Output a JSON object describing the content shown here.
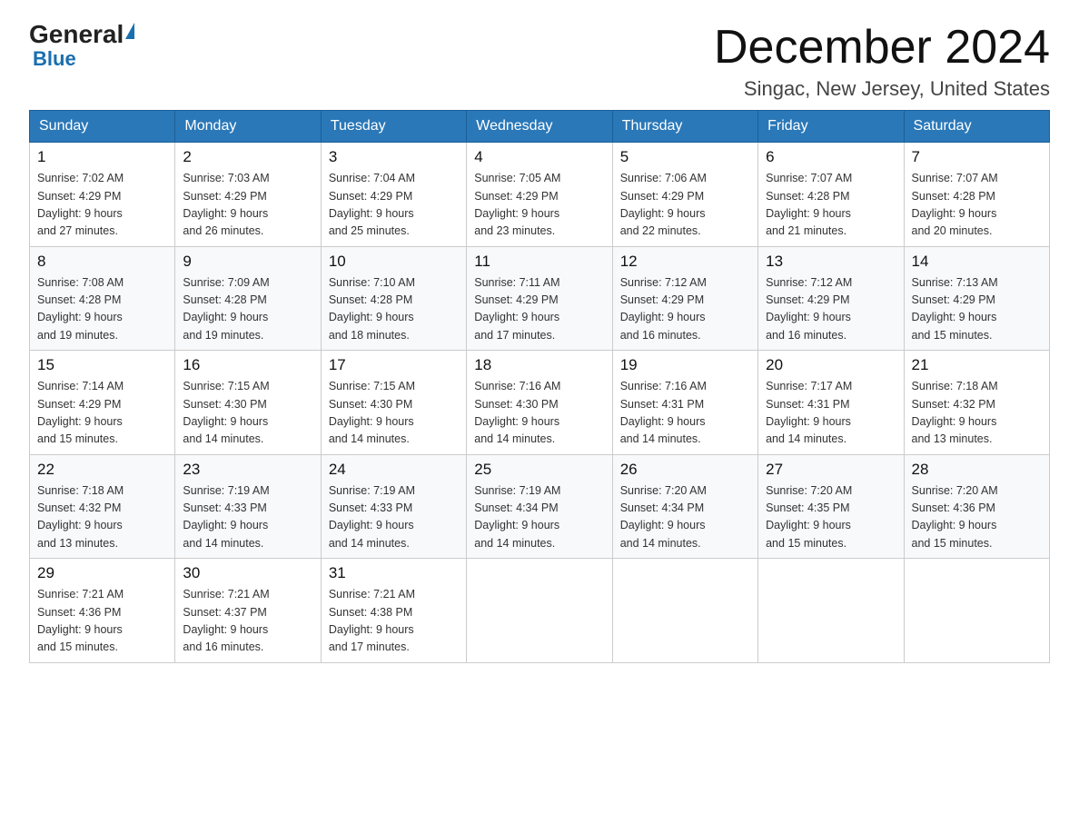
{
  "header": {
    "logo_general": "General",
    "logo_blue": "Blue",
    "month_title": "December 2024",
    "location": "Singac, New Jersey, United States"
  },
  "weekdays": [
    "Sunday",
    "Monday",
    "Tuesday",
    "Wednesday",
    "Thursday",
    "Friday",
    "Saturday"
  ],
  "weeks": [
    [
      {
        "day": "1",
        "sunrise": "7:02 AM",
        "sunset": "4:29 PM",
        "daylight": "9 hours and 27 minutes."
      },
      {
        "day": "2",
        "sunrise": "7:03 AM",
        "sunset": "4:29 PM",
        "daylight": "9 hours and 26 minutes."
      },
      {
        "day": "3",
        "sunrise": "7:04 AM",
        "sunset": "4:29 PM",
        "daylight": "9 hours and 25 minutes."
      },
      {
        "day": "4",
        "sunrise": "7:05 AM",
        "sunset": "4:29 PM",
        "daylight": "9 hours and 23 minutes."
      },
      {
        "day": "5",
        "sunrise": "7:06 AM",
        "sunset": "4:29 PM",
        "daylight": "9 hours and 22 minutes."
      },
      {
        "day": "6",
        "sunrise": "7:07 AM",
        "sunset": "4:28 PM",
        "daylight": "9 hours and 21 minutes."
      },
      {
        "day": "7",
        "sunrise": "7:07 AM",
        "sunset": "4:28 PM",
        "daylight": "9 hours and 20 minutes."
      }
    ],
    [
      {
        "day": "8",
        "sunrise": "7:08 AM",
        "sunset": "4:28 PM",
        "daylight": "9 hours and 19 minutes."
      },
      {
        "day": "9",
        "sunrise": "7:09 AM",
        "sunset": "4:28 PM",
        "daylight": "9 hours and 19 minutes."
      },
      {
        "day": "10",
        "sunrise": "7:10 AM",
        "sunset": "4:28 PM",
        "daylight": "9 hours and 18 minutes."
      },
      {
        "day": "11",
        "sunrise": "7:11 AM",
        "sunset": "4:29 PM",
        "daylight": "9 hours and 17 minutes."
      },
      {
        "day": "12",
        "sunrise": "7:12 AM",
        "sunset": "4:29 PM",
        "daylight": "9 hours and 16 minutes."
      },
      {
        "day": "13",
        "sunrise": "7:12 AM",
        "sunset": "4:29 PM",
        "daylight": "9 hours and 16 minutes."
      },
      {
        "day": "14",
        "sunrise": "7:13 AM",
        "sunset": "4:29 PM",
        "daylight": "9 hours and 15 minutes."
      }
    ],
    [
      {
        "day": "15",
        "sunrise": "7:14 AM",
        "sunset": "4:29 PM",
        "daylight": "9 hours and 15 minutes."
      },
      {
        "day": "16",
        "sunrise": "7:15 AM",
        "sunset": "4:30 PM",
        "daylight": "9 hours and 14 minutes."
      },
      {
        "day": "17",
        "sunrise": "7:15 AM",
        "sunset": "4:30 PM",
        "daylight": "9 hours and 14 minutes."
      },
      {
        "day": "18",
        "sunrise": "7:16 AM",
        "sunset": "4:30 PM",
        "daylight": "9 hours and 14 minutes."
      },
      {
        "day": "19",
        "sunrise": "7:16 AM",
        "sunset": "4:31 PM",
        "daylight": "9 hours and 14 minutes."
      },
      {
        "day": "20",
        "sunrise": "7:17 AM",
        "sunset": "4:31 PM",
        "daylight": "9 hours and 14 minutes."
      },
      {
        "day": "21",
        "sunrise": "7:18 AM",
        "sunset": "4:32 PM",
        "daylight": "9 hours and 13 minutes."
      }
    ],
    [
      {
        "day": "22",
        "sunrise": "7:18 AM",
        "sunset": "4:32 PM",
        "daylight": "9 hours and 13 minutes."
      },
      {
        "day": "23",
        "sunrise": "7:19 AM",
        "sunset": "4:33 PM",
        "daylight": "9 hours and 14 minutes."
      },
      {
        "day": "24",
        "sunrise": "7:19 AM",
        "sunset": "4:33 PM",
        "daylight": "9 hours and 14 minutes."
      },
      {
        "day": "25",
        "sunrise": "7:19 AM",
        "sunset": "4:34 PM",
        "daylight": "9 hours and 14 minutes."
      },
      {
        "day": "26",
        "sunrise": "7:20 AM",
        "sunset": "4:34 PM",
        "daylight": "9 hours and 14 minutes."
      },
      {
        "day": "27",
        "sunrise": "7:20 AM",
        "sunset": "4:35 PM",
        "daylight": "9 hours and 15 minutes."
      },
      {
        "day": "28",
        "sunrise": "7:20 AM",
        "sunset": "4:36 PM",
        "daylight": "9 hours and 15 minutes."
      }
    ],
    [
      {
        "day": "29",
        "sunrise": "7:21 AM",
        "sunset": "4:36 PM",
        "daylight": "9 hours and 15 minutes."
      },
      {
        "day": "30",
        "sunrise": "7:21 AM",
        "sunset": "4:37 PM",
        "daylight": "9 hours and 16 minutes."
      },
      {
        "day": "31",
        "sunrise": "7:21 AM",
        "sunset": "4:38 PM",
        "daylight": "9 hours and 17 minutes."
      },
      null,
      null,
      null,
      null
    ]
  ],
  "labels": {
    "sunrise": "Sunrise:",
    "sunset": "Sunset:",
    "daylight": "Daylight:"
  }
}
